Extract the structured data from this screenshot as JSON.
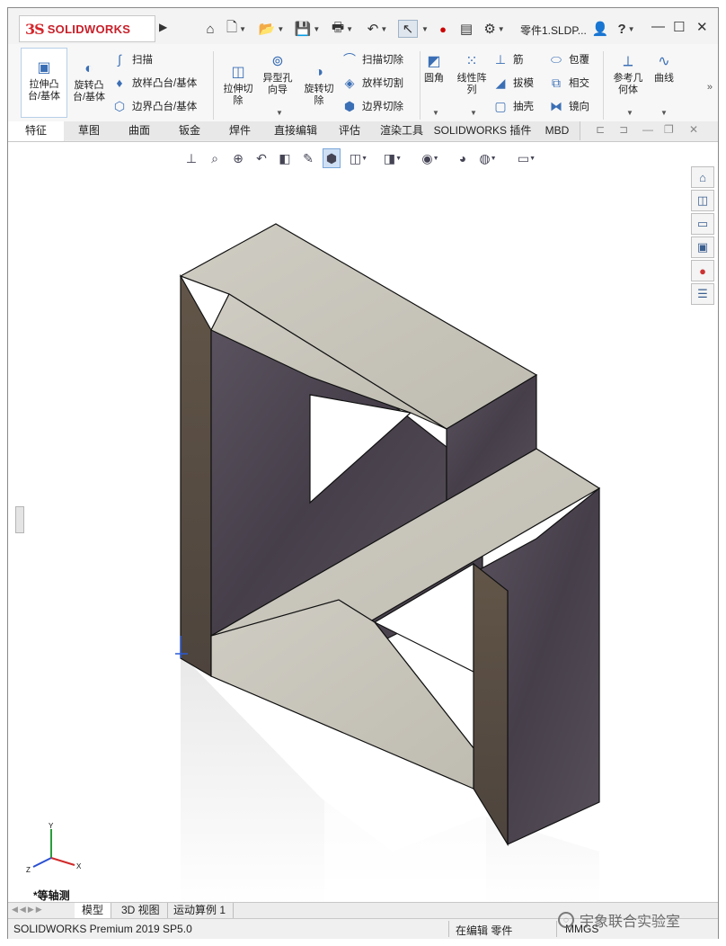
{
  "app": {
    "logo_mark": "3S",
    "logo_text": "SOLIDWORKS",
    "document_title": "零件1.SLDP..."
  },
  "quick_access": {
    "icons": [
      "home-icon",
      "new-document-icon",
      "open-icon",
      "save-icon",
      "print-icon",
      "undo-icon",
      "select-icon",
      "rebuild-icon",
      "file-properties-icon",
      "options-icon"
    ],
    "help": "?",
    "user_icon": "user-icon"
  },
  "window_controls": {
    "minimize": "—",
    "restore": "☐",
    "close": "✕"
  },
  "command_manager": {
    "extrude_boss": "拉伸凸\n台/基体",
    "revolve_boss": "旋转凸\n台/基体",
    "sweep": "扫描",
    "loft_boss": "放样凸台/基体",
    "boundary_boss": "边界凸台/基体",
    "extrude_cut": "拉伸切\n除",
    "hole_wizard": "异型孔\n向导",
    "revolve_cut": "旋转切\n除",
    "swept_cut": "扫描切除",
    "lofted_cut": "放样切割",
    "boundary_cut": "边界切除",
    "fillet": "圆角",
    "linear_pattern": "线性阵\n列",
    "rib": "筋",
    "draft": "拔模",
    "shell": "抽壳",
    "wrap": "包覆",
    "intersect": "相交",
    "mirror": "镜向",
    "reference_geometry": "参考几\n何体",
    "curves": "曲线"
  },
  "tabs": [
    {
      "label": "特征",
      "active": true
    },
    {
      "label": "草图",
      "active": false
    },
    {
      "label": "曲面",
      "active": false
    },
    {
      "label": "钣金",
      "active": false
    },
    {
      "label": "焊件",
      "active": false
    },
    {
      "label": "直接编辑",
      "active": false
    },
    {
      "label": "评估",
      "active": false
    },
    {
      "label": "渲染工具",
      "active": false
    },
    {
      "label": "SOLIDWORKS 插件",
      "active": false
    },
    {
      "label": "MBD",
      "active": false
    }
  ],
  "viewport": {
    "view_name": "*等轴测",
    "triad": {
      "x": "X",
      "y": "Y",
      "z": "Z"
    },
    "model_colors": {
      "top": "#c9c6bc",
      "side_dark": "#4e4852",
      "side_brown": "#5a4e45",
      "floor": "#d9d9d9"
    }
  },
  "bottom_tabs": [
    {
      "label": "模型",
      "active": true
    },
    {
      "label": "3D 视图",
      "active": false
    },
    {
      "label": "运动算例 1",
      "active": false
    }
  ],
  "status": {
    "product": "SOLIDWORKS Premium 2019 SP5.0",
    "mode": "在编辑 零件",
    "units": "MMGS"
  },
  "watermark": "宇象联合实验室"
}
